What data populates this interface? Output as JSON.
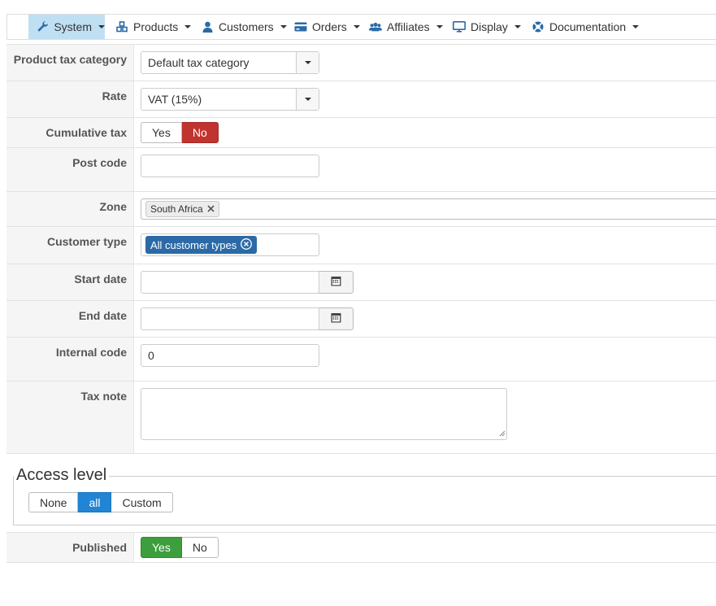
{
  "menu": [
    {
      "label": "System",
      "icon": "wrench-icon",
      "active": true
    },
    {
      "label": "Products",
      "icon": "cubes-icon"
    },
    {
      "label": "Customers",
      "icon": "user-icon"
    },
    {
      "label": "Orders",
      "icon": "credit-card-icon"
    },
    {
      "label": "Affiliates",
      "icon": "users-icon"
    },
    {
      "label": "Display",
      "icon": "monitor-icon"
    },
    {
      "label": "Documentation",
      "icon": "lifebuoy-icon"
    }
  ],
  "form": {
    "product_tax_category": {
      "label": "Product tax category",
      "value": "Default tax category"
    },
    "rate": {
      "label": "Rate",
      "value": "VAT (15%)"
    },
    "cumulative_tax": {
      "label": "Cumulative tax",
      "yes": "Yes",
      "no": "No",
      "selected": "No"
    },
    "post_code": {
      "label": "Post code",
      "value": ""
    },
    "zone": {
      "label": "Zone",
      "tags": [
        "South Africa"
      ]
    },
    "customer_type": {
      "label": "Customer type",
      "tags": [
        "All customer types"
      ]
    },
    "start_date": {
      "label": "Start date",
      "value": ""
    },
    "end_date": {
      "label": "End date",
      "value": ""
    },
    "internal_code": {
      "label": "Internal code",
      "value": "0"
    },
    "tax_note": {
      "label": "Tax note",
      "value": ""
    }
  },
  "access_level": {
    "legend": "Access level",
    "options": [
      "None",
      "all",
      "Custom"
    ],
    "selected": "all"
  },
  "published": {
    "label": "Published",
    "yes": "Yes",
    "no": "No",
    "selected": "Yes"
  },
  "colors": {
    "menu_active_bg": "#bfe0f3",
    "no_red": "#c1332f",
    "all_blue": "#2184d4",
    "yes_green": "#3c9e3c",
    "tag_blue": "#2b6aa6"
  }
}
